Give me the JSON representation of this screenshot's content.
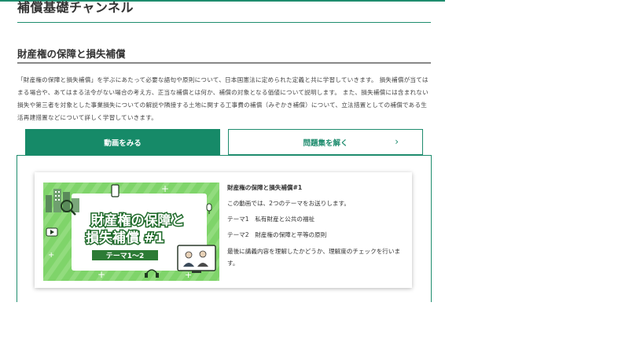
{
  "page": {
    "channel_title": "補償基礎チャンネル",
    "section_title": "財産権の保障と損失補償",
    "description": "「財産権の保障と損失補償」を学ぶにあたって必要な語句や原則について、日本国憲法に定められた定義と共に学習していきます。 損失補償が当てはまる場合や、あてはまる法令がない場合の考え方、正当な補償とは何か、補償の対象となる価値について説明します。 また、損失補償には含まれない損失や第三者を対象とした事業損失についての解説や隣接する土地に関する工事費の補償（みぞかき補償）について、立法措置としての補償である生活再建措置などについて詳しく学習していきます。"
  },
  "tabs": {
    "video_label": "動画をみる",
    "quiz_label": "問題集を解く",
    "quiz_chevron": "›"
  },
  "video": {
    "thumbnail": {
      "title_line1": "財産権の保障と",
      "title_line2": "損失補償 #1",
      "ribbon": "テーマ1～2"
    },
    "title": "財産権の保障と損失補償#1",
    "intro": "この動画では、2つのテーマをお送りします。",
    "theme1": "テーマ1　私有財産と公共の福祉",
    "theme2": "テーマ2　財産権の保障と平等の原則",
    "closing": "最後に講義内容を理解したかどうか、理解度のチェックを行います。"
  },
  "colors": {
    "brand_green": "#168a68",
    "thumb_green": "#7fd46a",
    "thumb_dark": "#1f6a2a"
  }
}
